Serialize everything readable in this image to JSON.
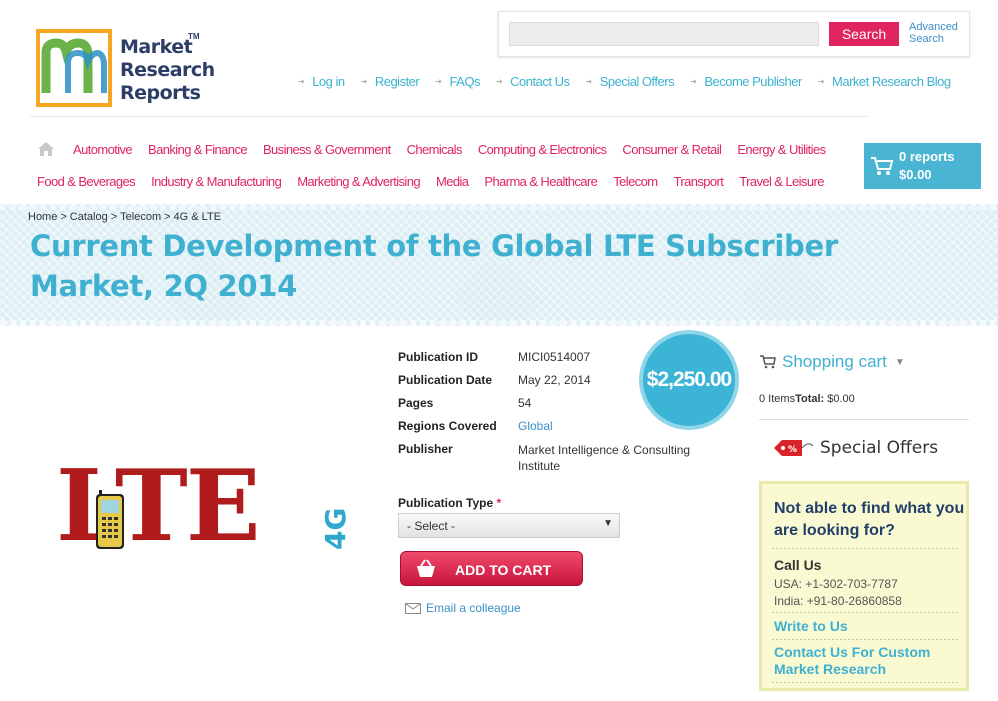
{
  "logo": {
    "line1": "Market",
    "line2": "Research",
    "line3": "Reports",
    "tm": "TM"
  },
  "search": {
    "placeholder": "",
    "button": "Search",
    "advanced_line1": "Advanced",
    "advanced_line2": "Search"
  },
  "top_links": [
    "Log in",
    "Register",
    "FAQs",
    "Contact Us",
    "Special Offers",
    "Become Publisher",
    "Market Research Blog"
  ],
  "categories_row1": [
    "Automotive",
    "Banking & Finance",
    "Business & Government",
    "Chemicals",
    "Computing & Electronics",
    "Consumer & Retail",
    "Energy & Utilities"
  ],
  "categories_row2": [
    "Food & Beverages",
    "Industry & Manufacturing",
    "Marketing & Advertising",
    "Media",
    "Pharma & Healthcare",
    "Telecom",
    "Transport",
    "Travel & Leisure"
  ],
  "cart": {
    "reports": "0 reports",
    "total": "$0.00"
  },
  "breadcrumb": [
    "Home",
    "Catalog",
    "Telecom",
    "4G & LTE"
  ],
  "page_title": "Current Development of the Global LTE Subscriber Market, 2Q 2014",
  "product_image": {
    "main_text": "LTE",
    "badge_text": "4G"
  },
  "details": {
    "publication_id_label": "Publication ID",
    "publication_id": "MICI0514007",
    "publication_date_label": "Publication Date",
    "publication_date": "May 22, 2014",
    "pages_label": "Pages",
    "pages": "54",
    "regions_label": "Regions Covered",
    "regions": "Global",
    "publisher_label": "Publisher",
    "publisher": "Market Intelligence & Consulting Institute"
  },
  "price": "$2,250.00",
  "publication_type": {
    "label": "Publication Type",
    "required_mark": "*",
    "selected": "- Select -"
  },
  "add_to_cart": "ADD TO CART",
  "email_colleague": "Email a colleague",
  "sidebar": {
    "shopping_cart": "Shopping cart",
    "items_text": "0 Items",
    "total_label": "Total:",
    "total_value": "$0.00",
    "special_offers": "Special Offers",
    "help_title": "Not able to find what you are looking for?",
    "call_us": "Call Us",
    "usa_phone": "USA: +1-302-703-7787",
    "india_phone": "India: +91-80-26860858",
    "write_to_us": "Write to Us",
    "contact_custom": "Contact Us For Custom Market Research"
  },
  "colors": {
    "accent_pink": "#e0245e",
    "accent_blue": "#3fb0d0",
    "cart_blue": "#4ab4d3"
  }
}
